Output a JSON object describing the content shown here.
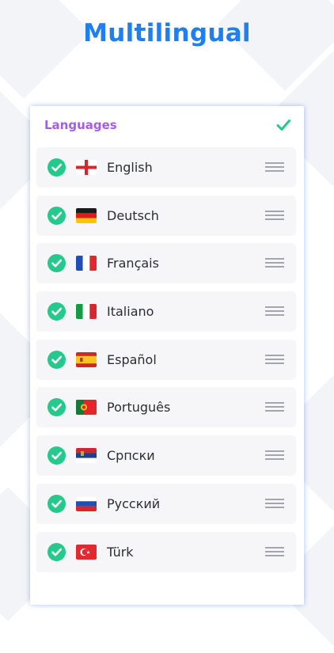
{
  "headline": "Multilingual",
  "card": {
    "title": "Languages",
    "confirm_icon": "checkmark-icon"
  },
  "colors": {
    "headline": "#1f7ef0",
    "title": "#a45cf0",
    "check": "#24c98b",
    "row_bg": "#f6f6f8"
  },
  "languages": [
    {
      "label": "English",
      "flag": "england-flag-icon",
      "checked": true
    },
    {
      "label": "Deutsch",
      "flag": "germany-flag-icon",
      "checked": true
    },
    {
      "label": "Français",
      "flag": "france-flag-icon",
      "checked": true
    },
    {
      "label": "Italiano",
      "flag": "italy-flag-icon",
      "checked": true
    },
    {
      "label": "Español",
      "flag": "spain-flag-icon",
      "checked": true
    },
    {
      "label": "Português",
      "flag": "portugal-flag-icon",
      "checked": true
    },
    {
      "label": "Српски",
      "flag": "serbia-flag-icon",
      "checked": true
    },
    {
      "label": "Русский",
      "flag": "russia-flag-icon",
      "checked": true
    },
    {
      "label": "Türk",
      "flag": "turkey-flag-icon",
      "checked": true
    }
  ],
  "row_icons": {
    "check": "check-circle-icon",
    "drag": "drag-handle-icon"
  }
}
